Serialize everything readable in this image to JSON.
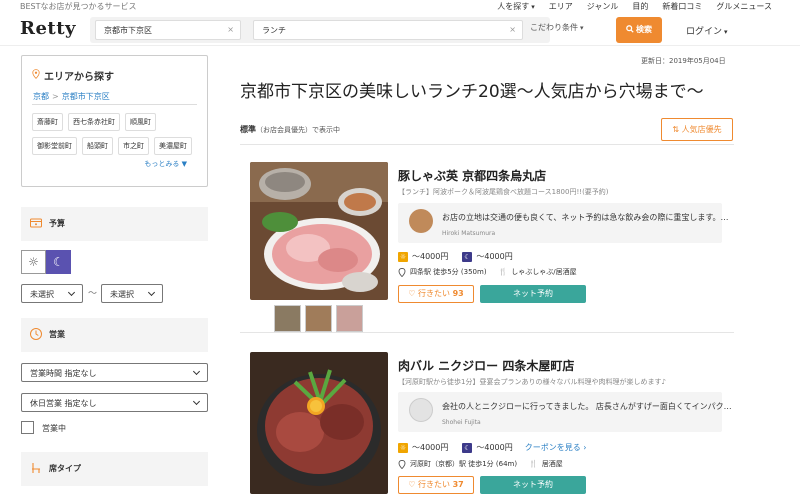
{
  "topbar": {
    "tagline": "BESTなお店が見つかるサービス",
    "nav": [
      "人を探す",
      "エリア",
      "ジャンル",
      "目的",
      "新着口コミ",
      "グルメニュース"
    ]
  },
  "header": {
    "logo": "Retty",
    "area_value": "京都市下京区",
    "keyword_value": "ランチ",
    "clear_icon": "×",
    "kodawari": "こだわり条件",
    "search_label": "検索",
    "login": "ログイン"
  },
  "sidebar": {
    "area_title": "エリアから探す",
    "crumb_1": "京都",
    "crumb_sep": ">",
    "crumb_2": "京都市下京区",
    "towns": [
      "斎藤町",
      "西七条赤社町",
      "順風町",
      "御影堂前町",
      "船頭町",
      "市之町",
      "美濃屋町"
    ],
    "more": "もっとみる",
    "budget_title": "予算",
    "budget_min": "未選択",
    "budget_tilde": "〜",
    "budget_max": "未選択",
    "hours_title": "営業",
    "hours_select": "営業時間 指定なし",
    "holiday_select": "休日営業 指定なし",
    "open_now": "営業中",
    "seat_title": "席タイプ"
  },
  "main": {
    "updated": "更新日：2019年05月04日",
    "title": "京都市下京区の美味しいランチ20選〜人気店から穴場まで〜",
    "sort_label": "標準",
    "sort_note": "（お店会員優先）で表示中",
    "sort_button": "人気店優先",
    "restaurants": [
      {
        "name": "豚しゃぶ英 京都四条烏丸店",
        "catch": "【ランチ】阿波ポーク＆阿波尾鶏食べ放題コース1800円!!(要予約)",
        "review": "お店の立地は交通の便も良くて、ネット予約は急な飲み会の際に重宝します。…",
        "reviewer": "Hiroki Matsumura",
        "lunch_price": "〜4000円",
        "dinner_price": "〜4000円",
        "station": "四条駅 徒歩5分 (350m)",
        "genre": "しゃぶしゃぶ/居酒屋",
        "want_label": "行きたい",
        "want_count": "93",
        "reserve": "ネット予約"
      },
      {
        "name": "肉バル ニクジロー 四条木屋町店",
        "catch": "【河原町駅から徒歩1分】昼宴会プランありの様々なバル料理や肉料理が楽しめます♪",
        "review": "会社の人とニクジローに行ってきました。 店長さんがすげー面白くてインパク…",
        "reviewer": "Shohei Fujita",
        "lunch_price": "〜4000円",
        "dinner_price": "〜4000円",
        "coupon": "クーポンを見る",
        "station": "河原町（京都）駅 徒歩1分 (64m)",
        "genre": "居酒屋",
        "want_label": "行きたい",
        "want_count": "37",
        "reserve": "ネット予約"
      }
    ]
  },
  "colors": {
    "accent": "#ef8a30",
    "reserve": "#3aa69b",
    "link": "#2a7fc4",
    "night": "#5a52b0"
  }
}
